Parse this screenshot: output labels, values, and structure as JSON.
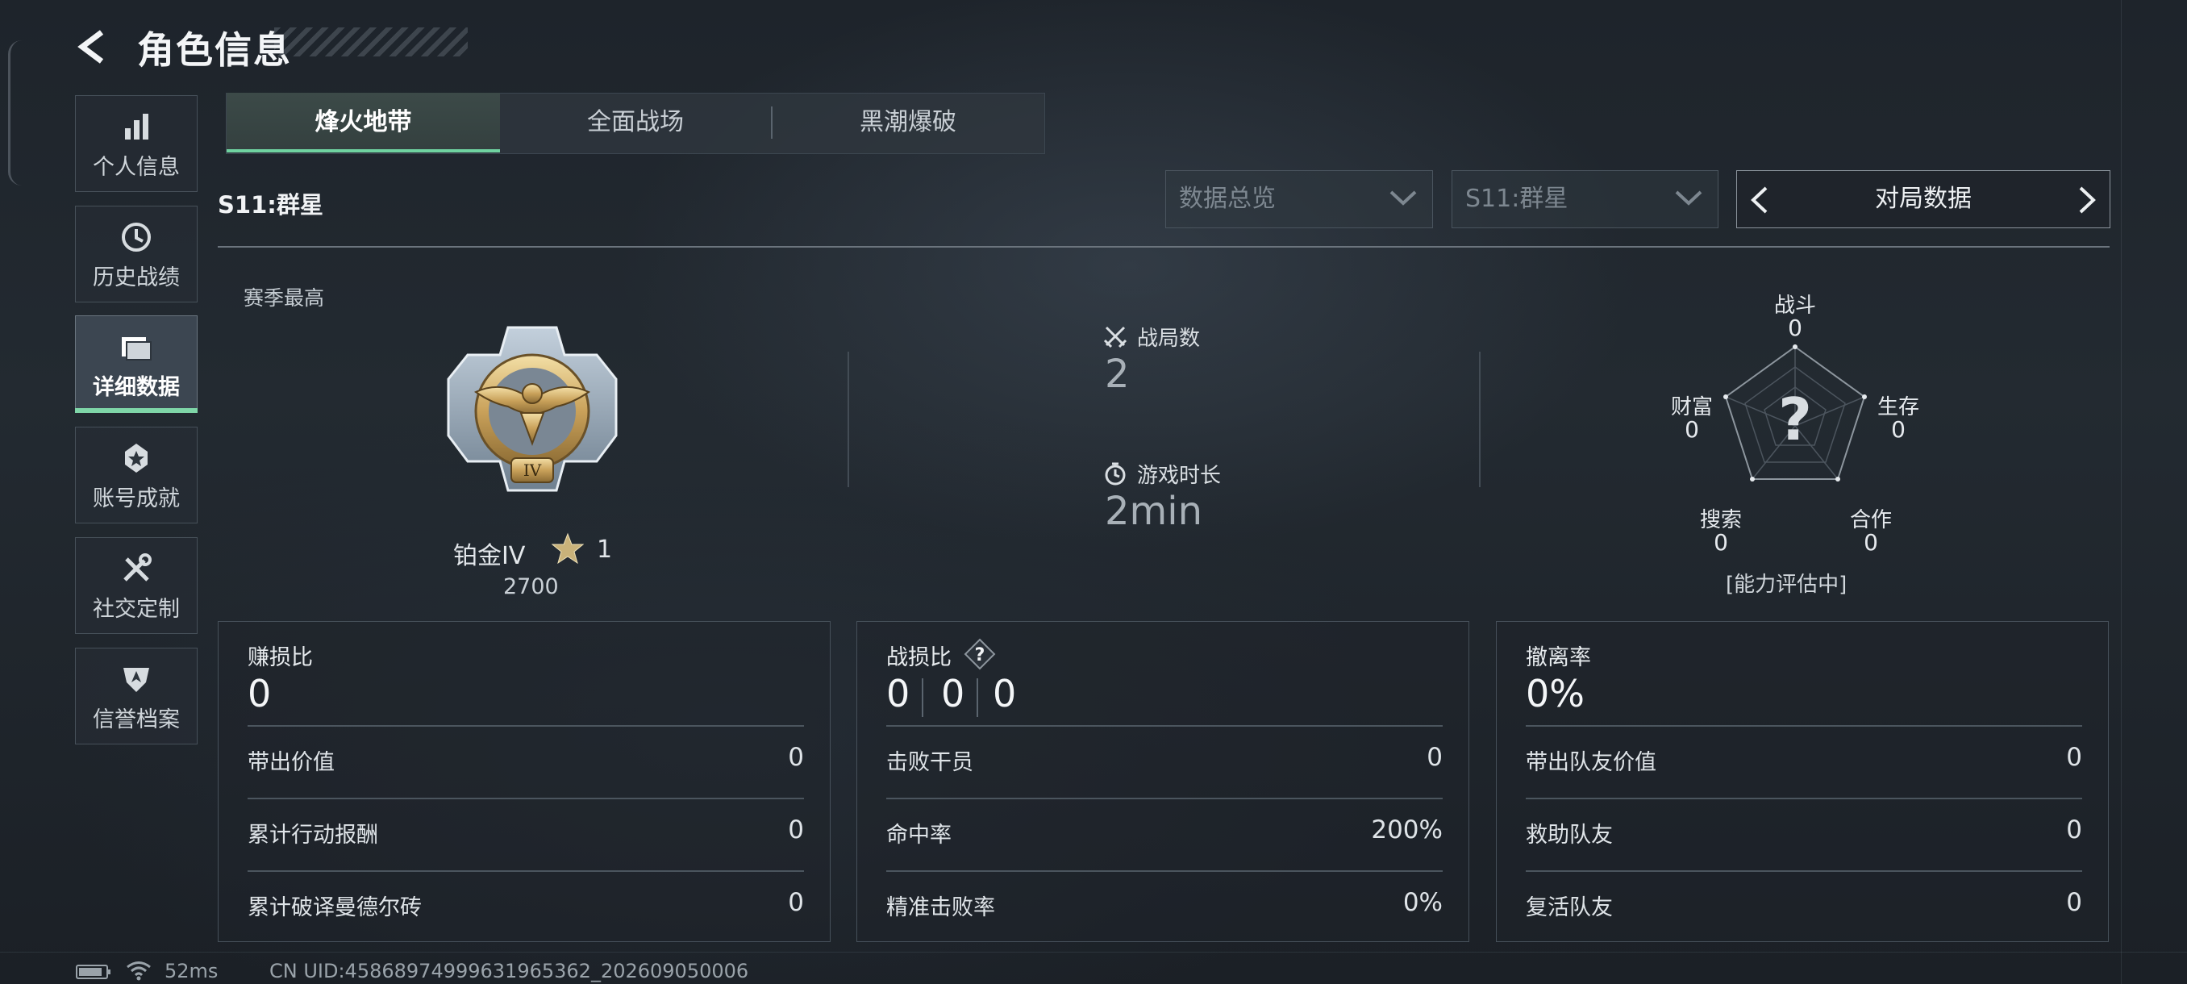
{
  "header": {
    "title": "角色信息"
  },
  "sidebar": {
    "items": [
      {
        "label": "个人信息",
        "icon": "bar-chart-icon"
      },
      {
        "label": "历史战绩",
        "icon": "history-clock-icon"
      },
      {
        "label": "详细数据",
        "icon": "folder-stack-icon",
        "active": true
      },
      {
        "label": "账号成就",
        "icon": "achievement-badge-icon"
      },
      {
        "label": "社交定制",
        "icon": "tools-wrench-icon"
      },
      {
        "label": "信誉档案",
        "icon": "shield-credit-icon"
      }
    ]
  },
  "tabs": [
    {
      "label": "烽火地带",
      "active": true
    },
    {
      "label": "全面战场"
    },
    {
      "label": "黑潮爆破"
    }
  ],
  "season_title": "S11:群星",
  "filters": {
    "data_overview": "数据总览",
    "season": "S11:群星",
    "pager_label": "对局数据"
  },
  "season_best": {
    "label": "赛季最高",
    "rank_name": "铂金IV",
    "stars": "1",
    "score": "2700"
  },
  "overview": {
    "matches_label": "战局数",
    "matches_value": "2",
    "playtime_label": "游戏时长",
    "playtime_value": "2min"
  },
  "radar": {
    "center_mark": "?",
    "labels": {
      "combat": "战斗",
      "survival": "生存",
      "cooperation": "合作",
      "search": "搜索",
      "wealth": "财富"
    },
    "values": {
      "combat": "0",
      "survival": "0",
      "cooperation": "0",
      "search": "0",
      "wealth": "0"
    },
    "status": "[能力评估中]"
  },
  "panels": {
    "profit": {
      "title": "赚损比",
      "value": "0",
      "rows": [
        {
          "label": "带出价值",
          "value": "0"
        },
        {
          "label": "累计行动报酬",
          "value": "0"
        },
        {
          "label": "累计破译曼德尔砖",
          "value": "0"
        }
      ]
    },
    "kd": {
      "title": "战损比",
      "help": "?",
      "values": [
        "0",
        "0",
        "0"
      ],
      "rows": [
        {
          "label": "击败干员",
          "value": "0"
        },
        {
          "label": "命中率",
          "value": "200%"
        },
        {
          "label": "精准击败率",
          "value": "0%"
        }
      ]
    },
    "extract": {
      "title": "撤离率",
      "value": "0%",
      "rows": [
        {
          "label": "带出队友价值",
          "value": "0"
        },
        {
          "label": "救助队友",
          "value": "0"
        },
        {
          "label": "复活队友",
          "value": "0"
        }
      ]
    }
  },
  "footer": {
    "ping": "52ms",
    "uid": "CN UID:45868974999631965362_202609050006"
  },
  "colors": {
    "accent_green": "#6fd2a0",
    "background": "#1f252c",
    "panel_border": "#46505a"
  }
}
